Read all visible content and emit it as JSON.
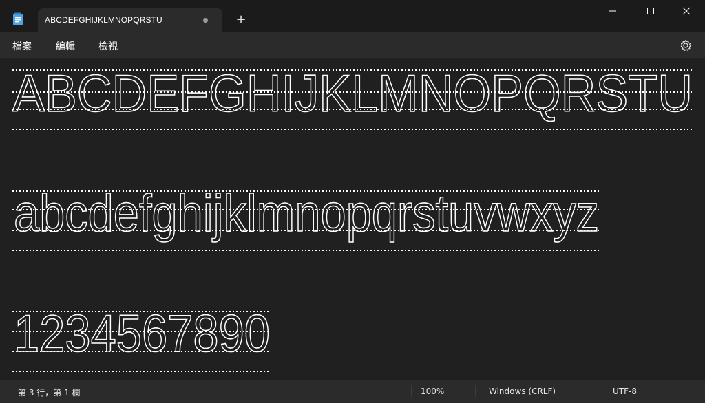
{
  "window": {
    "tab_title": "ABCDEFGHIJKLMNOPQRSTU",
    "new_tab_label": "+",
    "icons": {
      "app": "notepad-icon",
      "minimize": "minimize-icon",
      "maximize": "maximize-icon",
      "close": "close-icon",
      "settings": "gear-icon",
      "unsaved": "unsaved-dot-icon"
    }
  },
  "menu": {
    "file": "檔案",
    "edit": "編輯",
    "view": "檢視"
  },
  "editor": {
    "lines": [
      "ABCDEFGHIJKLMNOPQRSTU",
      "abcdefghijklmnopqrstuvwxyz",
      "1234567890"
    ]
  },
  "status": {
    "position": "第 3 行，第 1 欄",
    "zoom": "100%",
    "line_ending": "Windows (CRLF)",
    "encoding": "UTF-8"
  },
  "colors": {
    "background": "#202020",
    "chrome": "#2b2b2b",
    "text": "#ffffff"
  }
}
